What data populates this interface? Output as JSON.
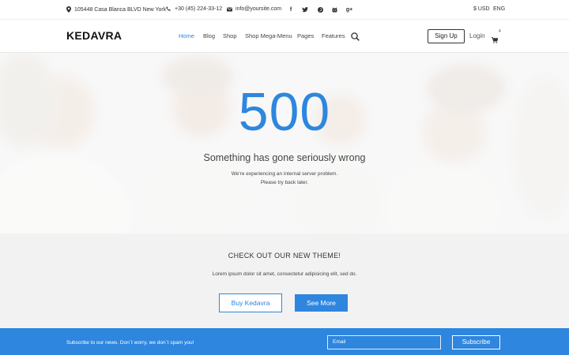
{
  "topbar": {
    "address": "105448 Casa Blanca BLVD New York",
    "phone": "+30 (45) 224-33-12",
    "email": "info@yoursite.com",
    "social_icons": [
      "facebook-icon",
      "twitter-icon",
      "pinterest-icon",
      "github-icon",
      "google-plus-icon"
    ],
    "social": {
      "facebook": "f",
      "googleplus": "g+"
    },
    "currency": "$ USD",
    "language": "ENG"
  },
  "nav": {
    "logo": "KEDAVRA",
    "items": [
      "Home",
      "Blog",
      "Shop",
      "Shop Mega-Menu",
      "Pages",
      "Features"
    ],
    "active_item": "Home",
    "signup": "Sign Up",
    "login": "Login",
    "cart_count": "4"
  },
  "hero": {
    "code": "500",
    "headline": "Something has gone seriously wrong",
    "line1": "We're experiencing an internal server problem.",
    "line2": "Please try back later."
  },
  "promo": {
    "title": "CHECK OUT OUR NEW THEME!",
    "text": "Lorem ipsum dolor sit amet, consectetur adipisicing elit, sed do.",
    "buy_label": "Buy Kedavra",
    "more_label": "See More"
  },
  "newsletter": {
    "text": "Subscribe to our news. Don`t worry, we don`t spam you!",
    "email_placeholder": "Email",
    "subscribe_label": "Subscribe"
  },
  "colors": {
    "accent": "#2e86de",
    "promo_bg": "#f2f2f2",
    "text_dark": "#333333"
  }
}
